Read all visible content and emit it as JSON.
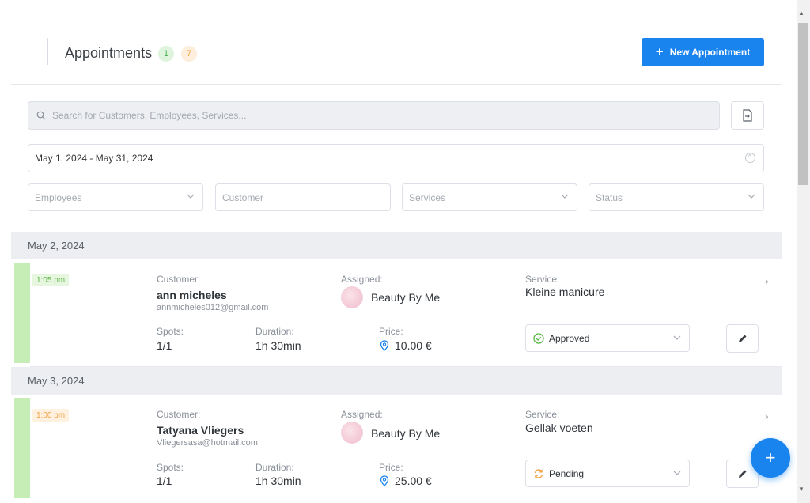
{
  "header": {
    "title": "Appointments",
    "badge_green": "1",
    "badge_orange": "7",
    "new_button_label": "New Appointment"
  },
  "search": {
    "placeholder": "Search for Customers, Employees, Services..."
  },
  "date_range": "May 1, 2024 - May 31, 2024",
  "filters": {
    "employees": "Employees",
    "customer": "Customer",
    "services": "Services",
    "status": "Status"
  },
  "labels": {
    "customer": "Customer:",
    "assigned": "Assigned:",
    "service": "Service:",
    "spots": "Spots:",
    "duration": "Duration:",
    "price": "Price:"
  },
  "groups": [
    {
      "date": "May 2, 2024",
      "appointment": {
        "time": "1:05 pm",
        "customer_name": "ann micheles",
        "customer_email": "annmicheles012@gmail.com",
        "assigned": "Beauty By Me",
        "service": "Kleine manicure",
        "spots": "1/1",
        "duration": "1h 30min",
        "price": "10.00 €",
        "status": "Approved"
      }
    },
    {
      "date": "May 3, 2024",
      "appointment": {
        "time": "1:00 pm",
        "customer_name": "Tatyana Vliegers",
        "customer_email": "Vliegersasa@hotmail.com",
        "assigned": "Beauty By Me",
        "service": "Gellak voeten",
        "spots": "1/1",
        "duration": "1h 30min",
        "price": "25.00 €",
        "status": "Pending"
      }
    }
  ],
  "colors": {
    "accent": "#1a84ee",
    "approved": "#5cb646",
    "pending": "#f0a040",
    "row_bar": "#c5edb5"
  }
}
